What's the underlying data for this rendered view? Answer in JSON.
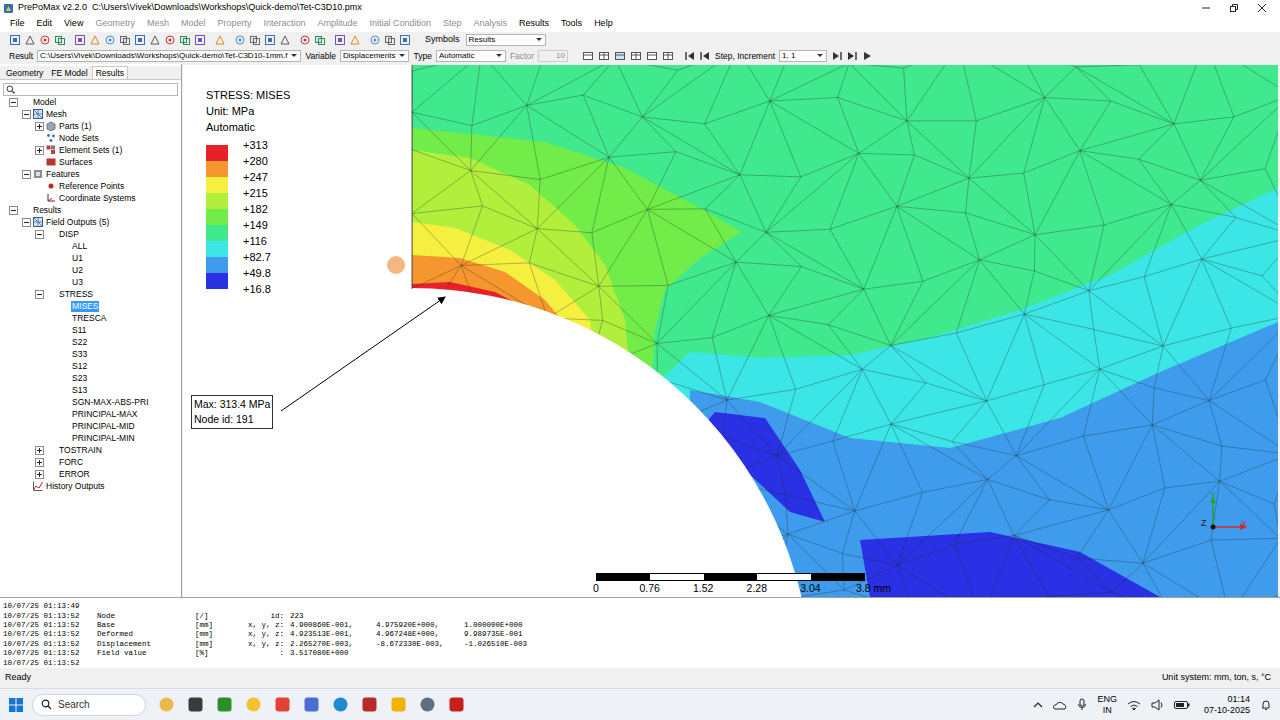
{
  "window": {
    "title": "PrePoMax v2.2.0  C:\\Users\\Vivek\\Downloads\\Workshops\\Quick-demo\\Tet-C3D10.pmx"
  },
  "menu": [
    {
      "label": "File",
      "disabled": false
    },
    {
      "label": "Edit",
      "disabled": false
    },
    {
      "label": "View",
      "disabled": false
    },
    {
      "label": "Geometry",
      "disabled": true
    },
    {
      "label": "Mesh",
      "disabled": true
    },
    {
      "label": "Model",
      "disabled": true
    },
    {
      "label": "Property",
      "disabled": true
    },
    {
      "label": "Interaction",
      "disabled": true
    },
    {
      "label": "Amplitude",
      "disabled": true
    },
    {
      "label": "Initial Condition",
      "disabled": true
    },
    {
      "label": "Step",
      "disabled": true
    },
    {
      "label": "Analysis",
      "disabled": true
    },
    {
      "label": "Results",
      "disabled": false
    },
    {
      "label": "Tools",
      "disabled": false
    },
    {
      "label": "Help",
      "disabled": false
    }
  ],
  "toolbar": {
    "symbols_label": "Symbols",
    "symbols_value": "Results"
  },
  "result_bar": {
    "result_label": "Result",
    "result_file": "C:\\Users\\Vivek\\Downloads\\Workshops\\Quick-demo\\Tet-C3D10-1mm.f",
    "variable_label": "Variable",
    "variable_value": "Displacements",
    "type_label": "Type",
    "type_value": "Automatic",
    "factor_label": "Factor",
    "factor_value": "10",
    "factor_disabled": true,
    "step_label": "Step, Increment",
    "step_value": "1, 1"
  },
  "panel_tabs": [
    {
      "label": "Geometry",
      "selected": false
    },
    {
      "label": "FE Model",
      "selected": false
    },
    {
      "label": "Results",
      "selected": true
    }
  ],
  "tree": [
    {
      "label": "Model",
      "level": 0,
      "kind": "none",
      "has_children": true,
      "expanded": true,
      "selected": false
    },
    {
      "label": "Mesh",
      "level": 1,
      "kind": "mesh",
      "has_children": true,
      "expanded": true,
      "selected": false
    },
    {
      "label": "Parts (1)",
      "level": 2,
      "kind": "parts",
      "has_children": true,
      "expanded": false,
      "selected": false
    },
    {
      "label": "Node Sets",
      "level": 2,
      "kind": "nodeset",
      "has_children": false,
      "expanded": false,
      "selected": false
    },
    {
      "label": "Element Sets (1)",
      "level": 2,
      "kind": "elset",
      "has_children": true,
      "expanded": false,
      "selected": false
    },
    {
      "label": "Surfaces",
      "level": 2,
      "kind": "surface",
      "has_children": false,
      "expanded": false,
      "selected": false
    },
    {
      "label": "Features",
      "level": 1,
      "kind": "features",
      "has_children": true,
      "expanded": true,
      "selected": false
    },
    {
      "label": "Reference Points",
      "level": 2,
      "kind": "refpoint",
      "has_children": false,
      "expanded": false,
      "selected": false
    },
    {
      "label": "Coordinate Systems",
      "level": 2,
      "kind": "csys",
      "has_children": false,
      "expanded": false,
      "selected": false
    },
    {
      "label": "Results",
      "level": 0,
      "kind": "none",
      "has_children": true,
      "expanded": true,
      "selected": false
    },
    {
      "label": "Field Outputs (5)",
      "level": 1,
      "kind": "field",
      "has_children": true,
      "expanded": true,
      "selected": false
    },
    {
      "label": "DISP",
      "level": 2,
      "kind": "none",
      "has_children": true,
      "expanded": true,
      "selected": false
    },
    {
      "label": "ALL",
      "level": 3,
      "kind": "none",
      "has_children": false,
      "expanded": false,
      "selected": false
    },
    {
      "label": "U1",
      "level": 3,
      "kind": "none",
      "has_children": false,
      "expanded": false,
      "selected": false
    },
    {
      "label": "U2",
      "level": 3,
      "kind": "none",
      "has_children": false,
      "expanded": false,
      "selected": false
    },
    {
      "label": "U3",
      "level": 3,
      "kind": "none",
      "has_children": false,
      "expanded": false,
      "selected": false
    },
    {
      "label": "STRESS",
      "level": 2,
      "kind": "none",
      "has_children": true,
      "expanded": true,
      "selected": false
    },
    {
      "label": "MISES",
      "level": 3,
      "kind": "none",
      "has_children": false,
      "expanded": false,
      "selected": true
    },
    {
      "label": "TRESCA",
      "level": 3,
      "kind": "none",
      "has_children": false,
      "expanded": false,
      "selected": false
    },
    {
      "label": "S11",
      "level": 3,
      "kind": "none",
      "has_children": false,
      "expanded": false,
      "selected": false
    },
    {
      "label": "S22",
      "level": 3,
      "kind": "none",
      "has_children": false,
      "expanded": false,
      "selected": false
    },
    {
      "label": "S33",
      "level": 3,
      "kind": "none",
      "has_children": false,
      "expanded": false,
      "selected": false
    },
    {
      "label": "S12",
      "level": 3,
      "kind": "none",
      "has_children": false,
      "expanded": false,
      "selected": false
    },
    {
      "label": "S23",
      "level": 3,
      "kind": "none",
      "has_children": false,
      "expanded": false,
      "selected": false
    },
    {
      "label": "S13",
      "level": 3,
      "kind": "none",
      "has_children": false,
      "expanded": false,
      "selected": false
    },
    {
      "label": "SGN-MAX-ABS-PRI",
      "level": 3,
      "kind": "none",
      "has_children": false,
      "expanded": false,
      "selected": false
    },
    {
      "label": "PRINCIPAL-MAX",
      "level": 3,
      "kind": "none",
      "has_children": false,
      "expanded": false,
      "selected": false
    },
    {
      "label": "PRINCIPAL-MID",
      "level": 3,
      "kind": "none",
      "has_children": false,
      "expanded": false,
      "selected": false
    },
    {
      "label": "PRINCIPAL-MIN",
      "level": 3,
      "kind": "none",
      "has_children": false,
      "expanded": false,
      "selected": false
    },
    {
      "label": "TOSTRAIN",
      "level": 2,
      "kind": "none",
      "has_children": true,
      "expanded": false,
      "selected": false
    },
    {
      "label": "FORC",
      "level": 2,
      "kind": "none",
      "has_children": true,
      "expanded": false,
      "selected": false
    },
    {
      "label": "ERROR",
      "level": 2,
      "kind": "none",
      "has_children": true,
      "expanded": false,
      "selected": false
    },
    {
      "label": "History Outputs",
      "level": 1,
      "kind": "history",
      "has_children": false,
      "expanded": false,
      "selected": false
    }
  ],
  "legend": {
    "title": "STRESS: MISES",
    "unit": "Unit: MPa",
    "mode": "Automatic",
    "labels": [
      "+313",
      "+280",
      "+247",
      "+215",
      "+182",
      "+149",
      "+116",
      "+82.7",
      "+49.8",
      "+16.8"
    ],
    "bands": [
      {
        "color": "#e8202a"
      },
      {
        "color": "#f5962e"
      },
      {
        "color": "#f5f040"
      },
      {
        "color": "#b2ef3c"
      },
      {
        "color": "#72ec48"
      },
      {
        "color": "#40e98e"
      },
      {
        "color": "#3ce6e6"
      },
      {
        "color": "#3f9ced"
      },
      {
        "color": "#2a30e4"
      }
    ]
  },
  "contour": {
    "regions": [
      {
        "band": 5
      },
      {
        "band": 6
      },
      {
        "band": 7
      },
      {
        "band": 8
      },
      {
        "band": 8
      },
      {
        "band": 4
      },
      {
        "band": 3
      },
      {
        "band": 2
      },
      {
        "band": 1
      },
      {
        "band": 0
      }
    ]
  },
  "annotation": {
    "lines": [
      "Max: 313.4 MPa",
      "Node id: 191"
    ]
  },
  "scale_bar": {
    "labels": [
      "0",
      "0.76",
      "1.52",
      "2.28",
      "3.04",
      "3.8 mm"
    ]
  },
  "triad": {
    "x": "X",
    "y": "Y",
    "z": "Z"
  },
  "log": [
    [
      "10/07/25 01:13:49"
    ],
    [
      "10/07/25 01:13:52",
      "Node",
      "[/]",
      "id:",
      "223"
    ],
    [
      "10/07/25 01:13:52",
      "Base",
      "[mm]",
      "x, y, z:",
      "4.900860E-001,",
      "4.975920E+000,",
      "1.000000E+000"
    ],
    [
      "10/07/25 01:13:52",
      "Deformed",
      "[mm]",
      "x, y, z:",
      "4.923513E-001,",
      "4.967248E+000,",
      "9.989735E-001"
    ],
    [
      "10/07/25 01:13:52",
      "Displacement",
      "[mm]",
      "x, y, z:",
      "2.265270E-003,",
      "-8.672330E-003,",
      "-1.026510E-003"
    ],
    [
      "10/07/25 01:13:52",
      "Field value",
      "[%]",
      ":",
      "3.517080E+000"
    ],
    [
      "10/07/25 01:13:52"
    ]
  ],
  "status_bar": {
    "left": "Ready",
    "right": "Unit system: mm, ton, s, °C"
  },
  "taskbar": {
    "search": "Search",
    "language": "ENG",
    "region": "IN",
    "time": "01:14",
    "date": "07-10-2025"
  }
}
